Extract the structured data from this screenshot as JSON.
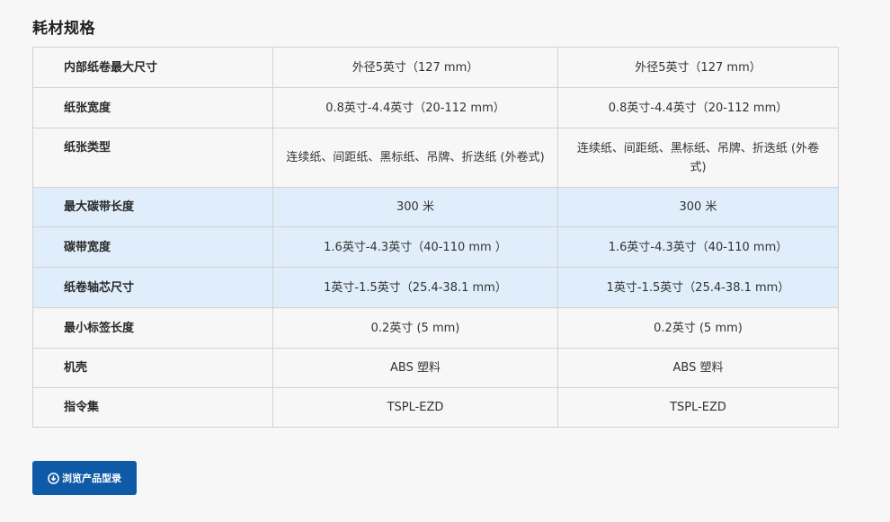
{
  "section": {
    "title": "耗材规格"
  },
  "specs": {
    "rows": [
      {
        "label": "内部纸卷最大尺寸",
        "col1": "外径5英寸（127 mm）",
        "col2": "外径5英寸（127 mm）"
      },
      {
        "label": "纸张宽度",
        "col1": "0.8英寸-4.4英寸（20-112 mm）",
        "col2": "0.8英寸-4.4英寸（20-112 mm）"
      },
      {
        "label": "纸张类型",
        "col1": "连续纸、间距纸、黑标纸、吊牌、折迭纸 (外卷式)",
        "col2": "连续纸、间距纸、黑标纸、吊牌、折迭纸 (外卷式)"
      },
      {
        "label": "最大碳带长度",
        "col1": "300 米",
        "col2": "300 米"
      },
      {
        "label": "碳带宽度",
        "col1": "1.6英寸-4.3英寸（40-110 mm ）",
        "col2": "1.6英寸-4.3英寸（40-110 mm）"
      },
      {
        "label": "纸卷轴芯尺寸",
        "col1": "1英寸-1.5英寸（25.4-38.1 mm）",
        "col2": "1英寸-1.5英寸（25.4-38.1 mm）"
      },
      {
        "label": "最小标签长度",
        "col1": "0.2英寸 (5 mm)",
        "col2": "0.2英寸 (5 mm)"
      },
      {
        "label": "机壳",
        "col1": "ABS 塑料",
        "col2": "ABS 塑料"
      },
      {
        "label": "指令集",
        "col1": "TSPL-EZD",
        "col2": "TSPL-EZD"
      }
    ],
    "highlight_color": "#dfeefa",
    "border_color": "#d2d2d2"
  },
  "catalog_button": {
    "label": "浏览产品型录",
    "icon": "download-circle-icon",
    "color": "#0f5aa6"
  }
}
